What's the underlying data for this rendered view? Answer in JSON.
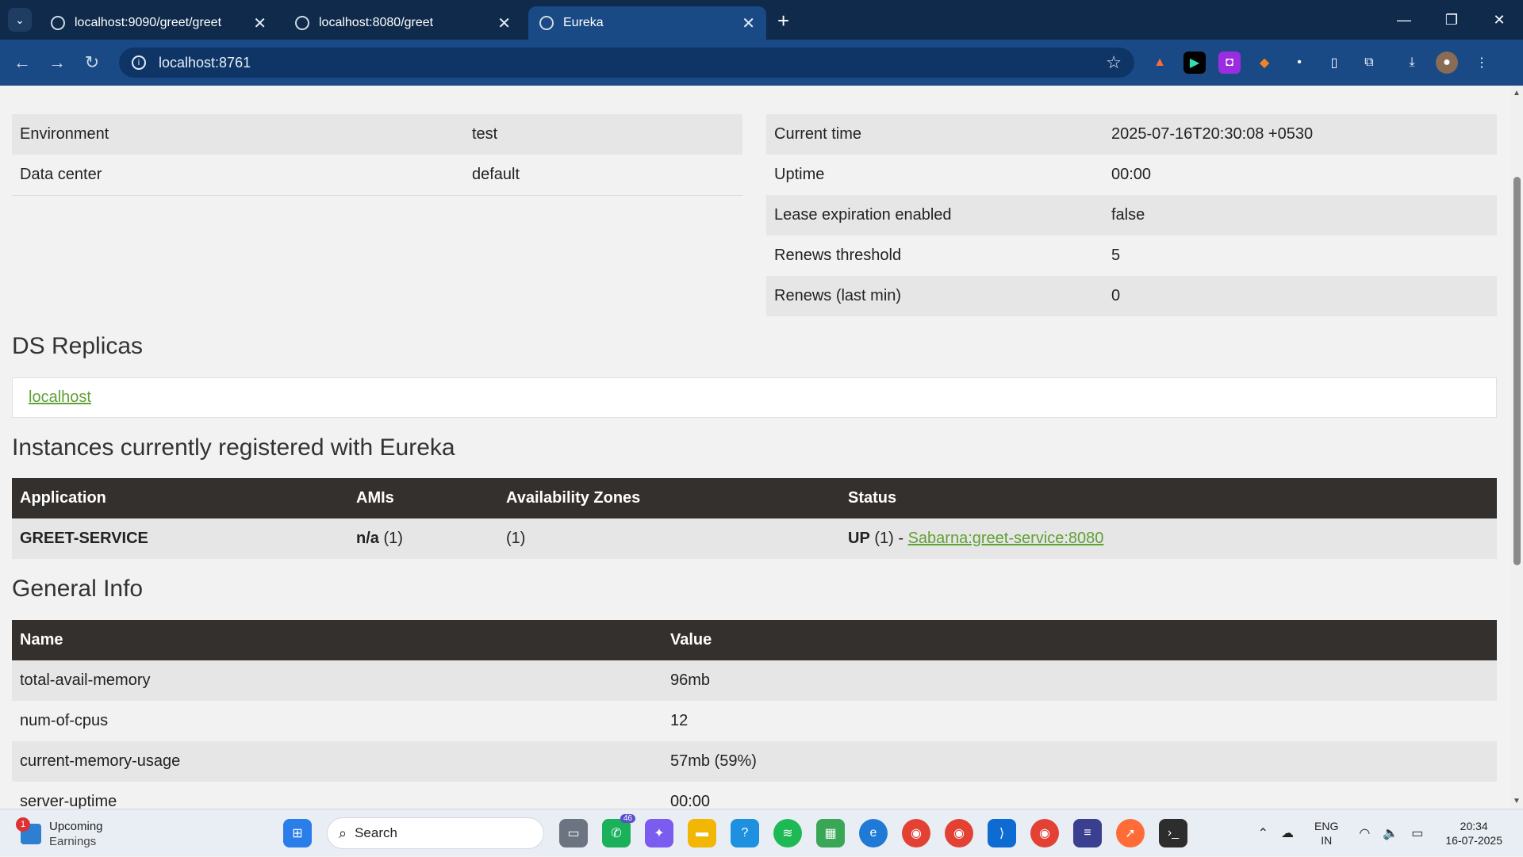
{
  "browser": {
    "tabs": [
      {
        "title": "localhost:9090/greet/greet",
        "active": false
      },
      {
        "title": "localhost:8080/greet",
        "active": false
      },
      {
        "title": "Eureka",
        "active": true
      }
    ],
    "url": "localhost:8761"
  },
  "page": {
    "system_status": {
      "left": [
        {
          "label": "Environment",
          "value": "test"
        },
        {
          "label": "Data center",
          "value": "default"
        }
      ],
      "right": [
        {
          "label": "Current time",
          "value": "2025-07-16T20:30:08 +0530"
        },
        {
          "label": "Uptime",
          "value": "00:00"
        },
        {
          "label": "Lease expiration enabled",
          "value": "false"
        },
        {
          "label": "Renews threshold",
          "value": "5"
        },
        {
          "label": "Renews (last min)",
          "value": "0"
        }
      ]
    },
    "ds_replicas": {
      "heading": "DS Replicas",
      "link": "localhost"
    },
    "instances": {
      "heading": "Instances currently registered with Eureka",
      "columns": [
        "Application",
        "AMIs",
        "Availability Zones",
        "Status"
      ],
      "row": {
        "application": "GREET-SERVICE",
        "amis_bold": "n/a",
        "amis_count": " (1)",
        "zones": "(1)",
        "status_bold": "UP",
        "status_count": " (1) - ",
        "status_link": "Sabarna:greet-service:8080"
      }
    },
    "general_info": {
      "heading": "General Info",
      "columns": [
        "Name",
        "Value"
      ],
      "rows": [
        {
          "name": "total-avail-memory",
          "value": "96mb"
        },
        {
          "name": "num-of-cpus",
          "value": "12"
        },
        {
          "name": "current-memory-usage",
          "value": "57mb (59%)"
        },
        {
          "name": "server-uptime",
          "value": "00:00"
        }
      ]
    }
  },
  "taskbar": {
    "widget_title": "Upcoming",
    "widget_subtitle": "Earnings",
    "widget_badge": "1",
    "search_label": "Search",
    "whatsapp_badge": "46",
    "lang_top": "ENG",
    "lang_bottom": "IN",
    "time": "20:34",
    "date": "16-07-2025"
  }
}
